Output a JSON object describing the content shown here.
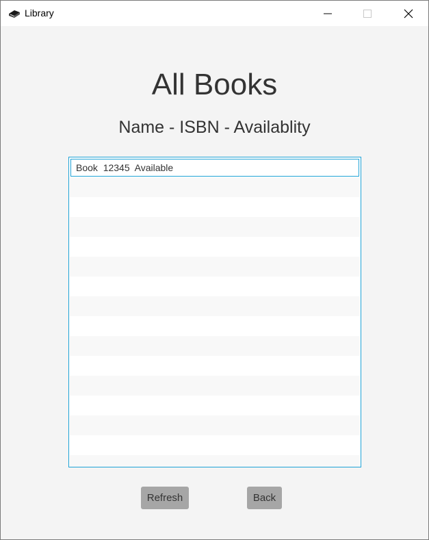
{
  "window": {
    "title": "Library",
    "icon": "book-icon"
  },
  "main": {
    "heading": "All Books",
    "subheading": "Name - ISBN - Availablity"
  },
  "books_list": {
    "items": [
      {
        "name": "Book",
        "isbn": "12345",
        "availability": "Available",
        "display": "Book  12345  Available"
      }
    ],
    "selected_index": 0
  },
  "buttons": {
    "refresh_label": "Refresh",
    "back_label": "Back"
  },
  "colors": {
    "accent": "#1ea2d6",
    "button_bg": "#a6a6a6",
    "window_bg": "#f4f4f4"
  }
}
